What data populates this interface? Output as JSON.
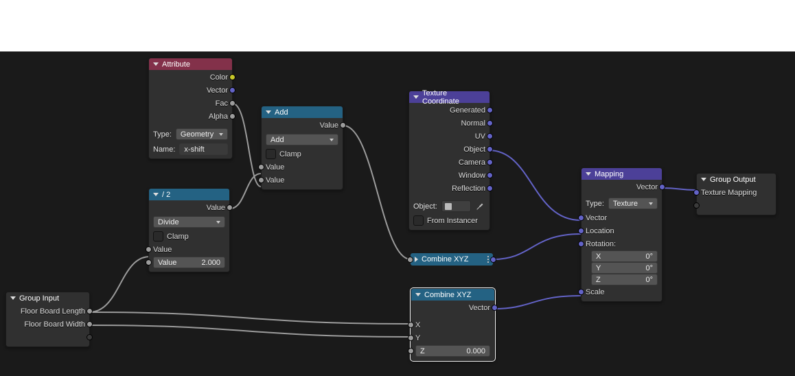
{
  "nodes": {
    "groupInput": {
      "title": "Group Input",
      "out1": "Floor Board Length",
      "out2": "Floor Board Width"
    },
    "attribute": {
      "title": "Attribute",
      "out_color": "Color",
      "out_vector": "Vector",
      "out_fac": "Fac",
      "out_alpha": "Alpha",
      "type_label": "Type:",
      "type_value": "Geometry",
      "name_label": "Name:",
      "name_value": "x-shift"
    },
    "divide": {
      "title": "/ 2",
      "out_value": "Value",
      "op": "Divide",
      "clamp": "Clamp",
      "in_value": "Value",
      "const_label": "Value",
      "const_value": "2.000"
    },
    "add": {
      "title": "Add",
      "out_value": "Value",
      "op": "Add",
      "clamp": "Clamp",
      "in_value1": "Value",
      "in_value2": "Value"
    },
    "texCoord": {
      "title": "Texture Coordinate",
      "generated": "Generated",
      "normal": "Normal",
      "uv": "UV",
      "object_out": "Object",
      "camera": "Camera",
      "window": "Window",
      "reflection": "Reflection",
      "object_label": "Object:",
      "from_instancer": "From Instancer"
    },
    "combine1": {
      "title": "Combine XYZ"
    },
    "combine2": {
      "title": "Combine XYZ",
      "out_vector": "Vector",
      "x": "X",
      "y": "Y",
      "z_label": "Z",
      "z_value": "0.000"
    },
    "mapping": {
      "title": "Mapping",
      "out_vector": "Vector",
      "type_label": "Type:",
      "type_value": "Texture",
      "in_vector": "Vector",
      "in_location": "Location",
      "rotation_label": "Rotation:",
      "rx_label": "X",
      "rx_value": "0°",
      "ry_label": "Y",
      "ry_value": "0°",
      "rz_label": "Z",
      "rz_value": "0°",
      "in_scale": "Scale"
    },
    "groupOutput": {
      "title": "Group Output",
      "in1": "Texture Mapping"
    }
  }
}
